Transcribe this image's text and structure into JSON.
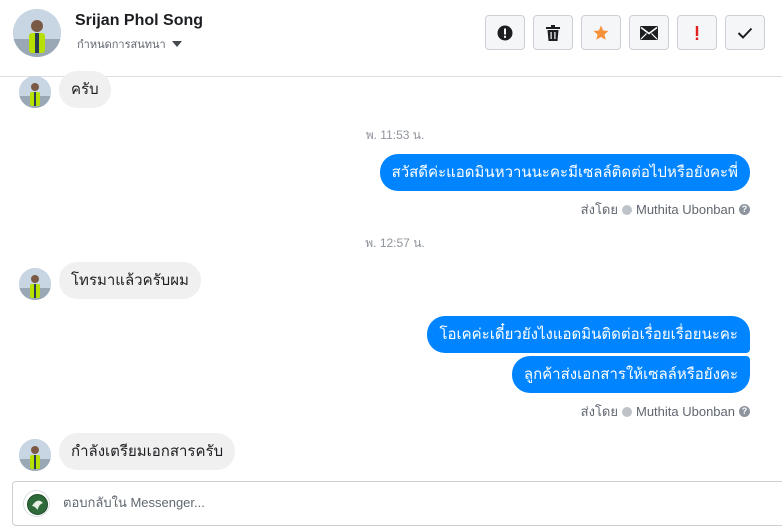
{
  "header": {
    "contact_name": "Srijan Phol Song",
    "subtitle": "กำหนดการสนทนา",
    "actions": [
      {
        "name": "block-icon"
      },
      {
        "name": "trash-icon"
      },
      {
        "name": "star-icon",
        "color": "#f7923b"
      },
      {
        "name": "mail-icon"
      },
      {
        "name": "spam-icon",
        "color": "#e02020"
      },
      {
        "name": "check-icon"
      }
    ]
  },
  "thread": {
    "messages": [
      {
        "direction": "in",
        "text": "ครับ"
      },
      {
        "type": "timestamp",
        "text": "พ. 11:53 น."
      },
      {
        "direction": "out",
        "text": "สวัสดีค่ะแอดมินหวานนะคะมีเซลล์ติดต่อไปหรือยังคะพี่"
      },
      {
        "type": "sent_by",
        "label": "ส่งโดย",
        "name": "Muthita Ubonban"
      },
      {
        "type": "timestamp",
        "text": "พ. 12:57 น."
      },
      {
        "direction": "in",
        "text": "โทรมาแล้วครับผม"
      },
      {
        "direction": "out",
        "text": "โอเคค่ะเดี๋ยวยังไงแอดมินติดต่อเรื่อยเรื่อยนะคะ"
      },
      {
        "direction": "out",
        "text": "ลูกค้าส่งเอกสารให้เซลล์หรือยังคะ"
      },
      {
        "type": "sent_by",
        "label": "ส่งโดย",
        "name": "Muthita Ubonban"
      },
      {
        "direction": "in",
        "text": "กำลังเตรียมเอกสารครับ"
      }
    ]
  },
  "composer": {
    "placeholder": "ตอบกลับใน Messenger..."
  },
  "colors": {
    "outgoing_bubble": "#0084ff",
    "incoming_bubble": "#f1f0f0"
  }
}
